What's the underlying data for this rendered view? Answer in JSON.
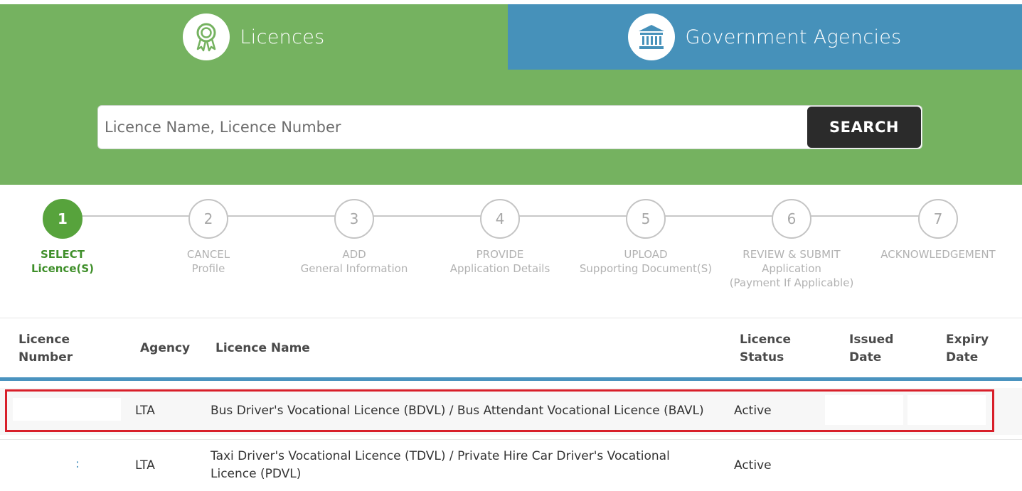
{
  "tabs": [
    {
      "label": "Licences",
      "icon": "ribbon-award-icon",
      "color": "#75b260"
    },
    {
      "label": "Government Agencies",
      "icon": "government-building-icon",
      "color": "#4691ba"
    }
  ],
  "search": {
    "placeholder": "Licence Name, Licence Number",
    "value": "",
    "button_label": "SEARCH"
  },
  "steps": [
    {
      "number": "1",
      "title": "SELECT",
      "subtitle": "Licence(S)",
      "subtitle2": "",
      "state": "active"
    },
    {
      "number": "2",
      "title": "CANCEL",
      "subtitle": "Profile",
      "subtitle2": "",
      "state": "pending"
    },
    {
      "number": "3",
      "title": "ADD",
      "subtitle": "General Information",
      "subtitle2": "",
      "state": "pending"
    },
    {
      "number": "4",
      "title": "PROVIDE",
      "subtitle": "Application Details",
      "subtitle2": "",
      "state": "pending"
    },
    {
      "number": "5",
      "title": "UPLOAD",
      "subtitle": "Supporting Document(S)",
      "subtitle2": "",
      "state": "pending"
    },
    {
      "number": "6",
      "title": "REVIEW & SUBMIT",
      "subtitle": "Application",
      "subtitle2": "(Payment If Applicable)",
      "state": "pending"
    },
    {
      "number": "7",
      "title": "ACKNOWLEDGEMENT",
      "subtitle": "",
      "subtitle2": "",
      "state": "pending"
    }
  ],
  "table": {
    "headers": {
      "licence_number": "Licence\nNumber",
      "agency": "Agency",
      "licence_name": "Licence Name",
      "licence_status": "Licence\nStatus",
      "issued_date": "Issued\nDate",
      "expiry_date": "Expiry\nDate"
    },
    "rows": [
      {
        "licence_number": "",
        "agency": "LTA",
        "licence_name": "Bus Driver's Vocational Licence (BDVL) / Bus Attendant Vocational Licence (BAVL)",
        "licence_status": "Active",
        "issued_date": "",
        "expiry_date": "",
        "highlighted": true
      },
      {
        "licence_number": ":",
        "agency": "LTA",
        "licence_name": "Taxi Driver's Vocational Licence (TDVL) / Private Hire Car Driver's Vocational Licence (PDVL)",
        "licence_status": "Active",
        "issued_date": "",
        "expiry_date": "",
        "highlighted": false
      }
    ]
  },
  "colors": {
    "green": "#75b260",
    "blue": "#4691ba",
    "active_step": "#57a33c",
    "highlight_border": "#d81f2a"
  }
}
